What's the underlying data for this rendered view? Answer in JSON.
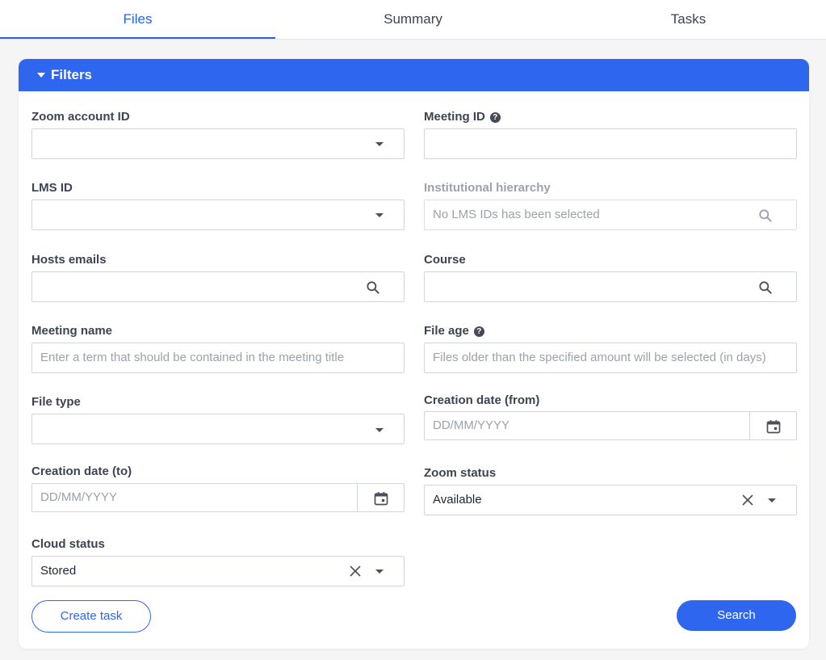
{
  "tabs": [
    {
      "label": "Files",
      "active": true
    },
    {
      "label": "Summary",
      "active": false
    },
    {
      "label": "Tasks",
      "active": false
    }
  ],
  "filters": {
    "title": "Filters",
    "zoom_account_id": {
      "label": "Zoom account ID",
      "value": ""
    },
    "meeting_id": {
      "label": "Meeting ID",
      "value": ""
    },
    "lms_id": {
      "label": "LMS ID",
      "value": ""
    },
    "institutional_hierarchy": {
      "label": "Institutional hierarchy",
      "placeholder": "No LMS IDs has been selected"
    },
    "hosts_emails": {
      "label": "Hosts emails",
      "value": ""
    },
    "course": {
      "label": "Course",
      "value": ""
    },
    "meeting_name": {
      "label": "Meeting name",
      "placeholder": "Enter a term that should be contained in the meeting title"
    },
    "file_age": {
      "label": "File age",
      "placeholder": "Files older than the specified amount will be selected (in days)"
    },
    "file_type": {
      "label": "File type",
      "value": ""
    },
    "creation_date_from": {
      "label": "Creation date (from)",
      "placeholder": "DD/MM/YYYY"
    },
    "creation_date_to": {
      "label": "Creation date (to)",
      "placeholder": "DD/MM/YYYY"
    },
    "zoom_status": {
      "label": "Zoom status",
      "value": "Available"
    },
    "cloud_status": {
      "label": "Cloud status",
      "value": "Stored"
    }
  },
  "actions": {
    "create_task": "Create task",
    "search": "Search"
  },
  "colors": {
    "accent": "#2f66f0",
    "tab_active": "#2563eb"
  }
}
